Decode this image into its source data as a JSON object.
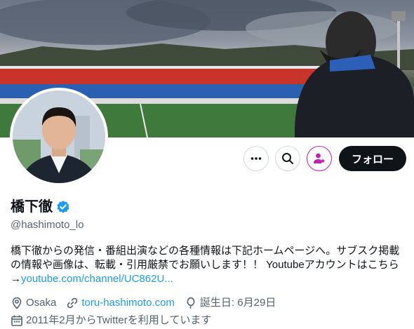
{
  "profile": {
    "display_name": "橋下徹",
    "handle": "@hashimoto_lo",
    "verified": true,
    "bio_text": "橋下徹からの発信・番組出演などの各種情報は下記ホームページへ。サブスク掲載の情報や画像は、転載・引用厳禁でお願いします！！ Youtubeアカウントはこちら→",
    "bio_link": "youtube.com/channel/UC862U..."
  },
  "actions": {
    "more_icon": "more-horizontal-icon",
    "search_icon": "search-icon",
    "subscribe_icon": "subscribe-person-star-icon",
    "follow_label": "フォロー"
  },
  "meta": {
    "location": "Osaka",
    "website": "toru-hashimoto.com",
    "birthday": "誕生日: 6月29日",
    "joined": "2011年2月からTwitterを利用しています"
  },
  "colors": {
    "accent": "#1d9bf0",
    "text": "#0f1419",
    "muted": "#536471",
    "subscribe": "#c51fb3",
    "follow_bg": "#0f1419"
  }
}
